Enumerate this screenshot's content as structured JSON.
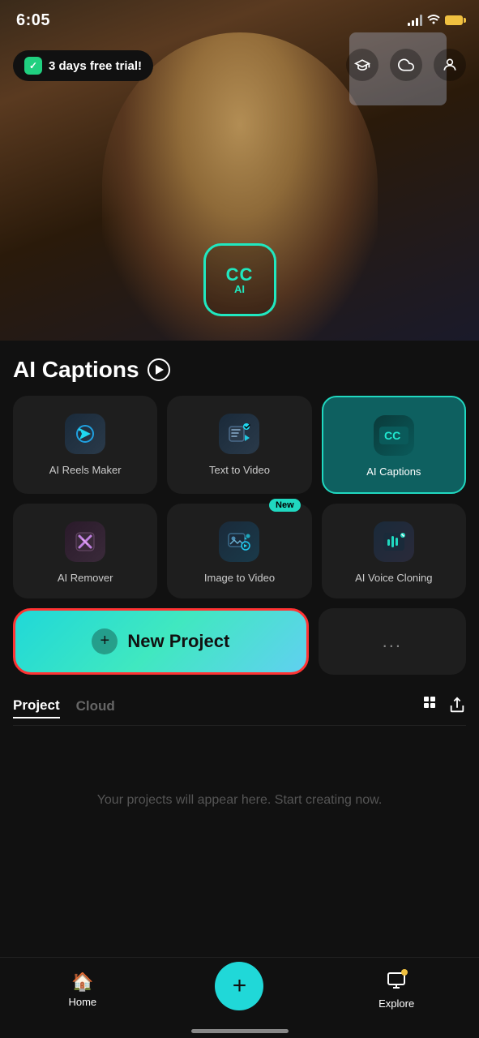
{
  "statusBar": {
    "time": "6:05"
  },
  "trialBadge": {
    "label": "3 days free trial!"
  },
  "hero": {
    "ccLogo": "CC",
    "aiLabel": "AI"
  },
  "section": {
    "title": "AI Captions"
  },
  "features": [
    {
      "id": "ai-reels",
      "label": "AI Reels Maker",
      "emoji": "⚡",
      "active": false,
      "new": false
    },
    {
      "id": "text-to-video",
      "label": "Text  to Video",
      "emoji": "✏️",
      "active": false,
      "new": false
    },
    {
      "id": "ai-captions",
      "label": "AI Captions",
      "emoji": "CC",
      "active": true,
      "new": false
    },
    {
      "id": "ai-remover",
      "label": "AI Remover",
      "emoji": "🧹",
      "active": false,
      "new": false
    },
    {
      "id": "image-to-video",
      "label": "Image to Video",
      "emoji": "🎬",
      "active": false,
      "new": true
    },
    {
      "id": "ai-voice",
      "label": "AI Voice Cloning",
      "emoji": "🎙️",
      "active": false,
      "new": false
    }
  ],
  "newProject": {
    "label": "New Project",
    "plusIcon": "+"
  },
  "moreDots": "...",
  "tabs": [
    {
      "id": "project",
      "label": "Project",
      "active": true
    },
    {
      "id": "cloud",
      "label": "Cloud",
      "active": false
    }
  ],
  "emptyState": {
    "text": "Your projects will appear here. Start creating now."
  },
  "bottomNav": [
    {
      "id": "home",
      "label": "Home",
      "icon": "🏠"
    },
    {
      "id": "add",
      "label": "",
      "icon": "+"
    },
    {
      "id": "explore",
      "label": "Explore",
      "icon": "🎬"
    }
  ]
}
